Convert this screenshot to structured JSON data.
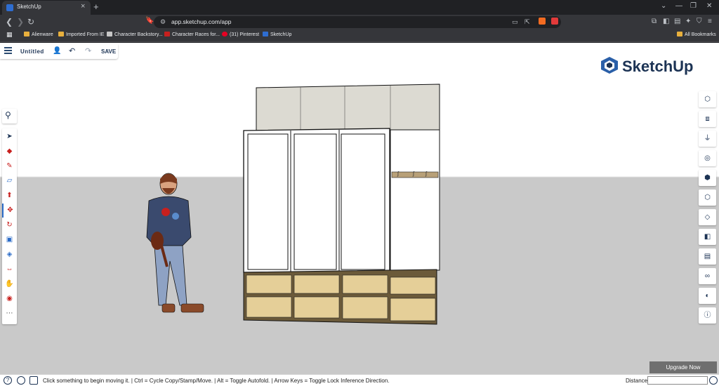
{
  "browser": {
    "tab_title": "SketchUp",
    "tab_close": "×",
    "new_tab": "+",
    "window_controls": [
      "⌄",
      "—",
      "❐",
      "✕"
    ],
    "url": "app.sketchup.com/app",
    "bookmarks": [
      "Alienware",
      "Imported From IE",
      "Character Backstory...",
      "Character Races for...",
      "(31) Pinterest",
      "SketchUp"
    ],
    "all_bookmarks": "All Bookmarks"
  },
  "app": {
    "doc_title": "Untitled",
    "save_label": "SAVE",
    "logo_text": "SketchUp",
    "status_message": "Click something to begin moving it. | Ctrl = Cycle Copy/Stamp/Move. | Alt = Toggle Autofold. | Arrow Keys = Toggle Lock Inference Direction.",
    "distance_label": "Distance",
    "distance_value": "",
    "upgrade_label": "Upgrade Now",
    "help_icon_glyph": "?",
    "active_tool": "move",
    "left_tools": [
      "select",
      "eraser",
      "pencil",
      "rectangle",
      "push-pull",
      "move",
      "rotate",
      "scale",
      "paint-bucket",
      "tape-measure",
      "orbit",
      "more"
    ],
    "right_tools": [
      "entity-info",
      "components",
      "materials",
      "styles",
      "scenes",
      "views",
      "layers",
      "instructor",
      "solid-tools",
      "outliner",
      "display",
      "model-info"
    ]
  }
}
